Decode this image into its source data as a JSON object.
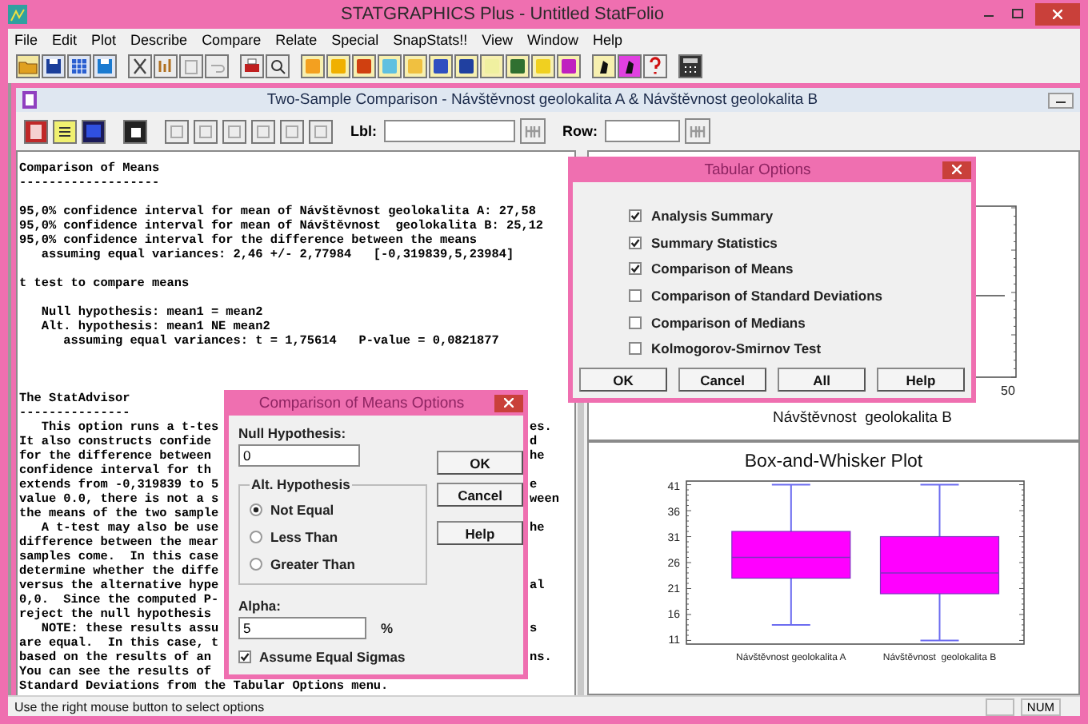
{
  "app_title": "STATGRAPHICS Plus - Untitled StatFolio",
  "menu": [
    "File",
    "Edit",
    "Plot",
    "Describe",
    "Compare",
    "Relate",
    "Special",
    "SnapStats!!",
    "View",
    "Window",
    "Help"
  ],
  "analysis_window": {
    "title": "Two-Sample Comparison - Návštěvnost geolokalita A & Návštěvnost  geolokalita B",
    "label_field": {
      "label": "Lbl:"
    },
    "row_field": {
      "label": "Row:"
    }
  },
  "output": {
    "sections": [
      {
        "kind": "result",
        "lines": [
          {
            "text": "Comparison of Means"
          },
          {
            "text": "-------------------"
          }
        ]
      },
      {
        "kind": "result",
        "lines": [
          {
            "text": "95,0% confidence interval for mean of Návštěvnost geolokalita A: 27,58"
          },
          {
            "text": "95,0% confidence interval for mean of Návštěvnost  geolokalita B: 25,12"
          },
          {
            "text": "95,0% confidence interval for the difference between the means"
          },
          {
            "text": "   assuming equal variances: 2,46 +/- 2,77984   [-0,319839,5,23984]"
          }
        ]
      },
      {
        "kind": "result",
        "lines": [
          {
            "text": "t test to compare means"
          }
        ]
      },
      {
        "kind": "result",
        "lines": [
          {
            "text": "   Null hypothesis: mean1 = mean2"
          },
          {
            "text": "   Alt. hypothesis: mean1 NE mean2"
          },
          {
            "text": "      assuming equal variances: t = 1,75614   P-value = 0,0821877"
          }
        ]
      },
      {
        "kind": "advisor",
        "lines": [
          {
            "text": "The StatAdvisor"
          },
          {
            "text": "---------------"
          },
          {
            "text": "   This option runs a t-tes",
            "after": "es."
          },
          {
            "text": "It also constructs confide",
            "after": "d"
          },
          {
            "text": "for the difference between",
            "after": "he"
          },
          {
            "text": "confidence interval for th"
          },
          {
            "text": "extends from -0,319839 to 5",
            "after": "e"
          },
          {
            "text": "value 0.0, there is not a s",
            "after": "ween"
          },
          {
            "text": "the means of the two sample"
          },
          {
            "text": "   A t-test may also be use",
            "after": "he"
          },
          {
            "text": "difference between the mear"
          },
          {
            "text": "samples come.  In this case"
          },
          {
            "text": "determine whether the diffe"
          },
          {
            "text": "versus the alternative hype",
            "after": "al"
          },
          {
            "text": "0,0.  Since the computed P-"
          },
          {
            "text": "reject the null hypothesis"
          },
          {
            "text": "   NOTE: these results assu",
            "after": "s"
          },
          {
            "text": "are equal.  In this case, t"
          },
          {
            "text": "based on the results of an",
            "after": "ns."
          },
          {
            "text": "You can see the results of"
          },
          {
            "text": "Standard Deviations from the Tabular Options menu."
          }
        ]
      }
    ]
  },
  "distribution_plot": {
    "xtick": "50",
    "xlabel": "Návštěvnost  geolokalita B"
  },
  "box_plot": {
    "title": "Box-and-Whisker Plot",
    "y_tick_labels": [
      "41",
      "36",
      "31",
      "26",
      "21",
      "16",
      "11"
    ],
    "categories": [
      "Návštěvnost geolokalita A",
      "Návštěvnost  geolokalita B"
    ]
  },
  "status_bar": {
    "message": "Use the right mouse button to select options",
    "indicator": "NUM"
  },
  "tabular_options": {
    "title": "Tabular Options",
    "options": [
      {
        "label": "Analysis Summary",
        "checked": true
      },
      {
        "label": "Summary Statistics",
        "checked": true
      },
      {
        "label": "Comparison of Means",
        "checked": true
      },
      {
        "label": "Comparison of Standard Deviations",
        "checked": false
      },
      {
        "label": "Comparison of Medians",
        "checked": false
      },
      {
        "label": "Kolmogorov-Smirnov Test",
        "checked": false
      }
    ],
    "buttons": [
      "OK",
      "Cancel",
      "All",
      "Help"
    ]
  },
  "means_options": {
    "title": "Comparison of Means Options",
    "null_hypothesis": {
      "label": "Null Hypothesis:",
      "value": "0"
    },
    "alt_hypothesis": {
      "label": "Alt. Hypothesis",
      "options": [
        {
          "label": "Not Equal",
          "selected": true
        },
        {
          "label": "Less Than",
          "selected": false
        },
        {
          "label": "Greater Than",
          "selected": false
        }
      ]
    },
    "alpha": {
      "label": "Alpha:",
      "value": "5",
      "unit": "%"
    },
    "equal_sigmas": {
      "label": "Assume Equal Sigmas",
      "checked": true
    },
    "buttons": [
      "OK",
      "Cancel",
      "Help"
    ]
  }
}
